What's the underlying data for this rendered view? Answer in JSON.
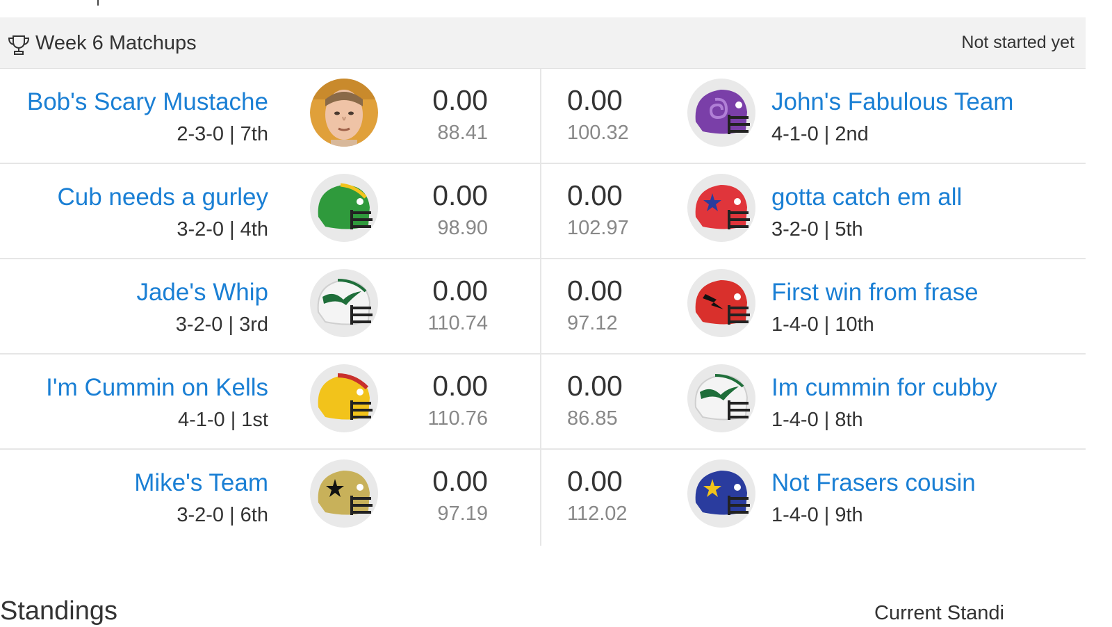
{
  "panel": {
    "title": "Week 6 Matchups",
    "status": "Not started yet",
    "icon": "trophy-icon"
  },
  "matchups": [
    {
      "home": {
        "name": "Bob's Scary Mustache",
        "record": "2-3-0 | 7th",
        "score": "0.00",
        "projected": "88.41",
        "avatar": "face-photo"
      },
      "away": {
        "name": "John's Fabulous Team",
        "record": "4-1-0 | 2nd",
        "score": "0.00",
        "projected": "100.32",
        "avatar": "helmet-purple-swirl",
        "helmet_color": "#7a3fa8"
      }
    },
    {
      "home": {
        "name": "Cub needs a gurley",
        "record": "3-2-0 | 4th",
        "score": "0.00",
        "projected": "98.90",
        "avatar": "helmet-green",
        "helmet_color": "#2f9a3c"
      },
      "away": {
        "name": "gotta catch em all",
        "record": "3-2-0 | 5th",
        "score": "0.00",
        "projected": "102.97",
        "avatar": "helmet-red-star",
        "helmet_color": "#e0353b"
      }
    },
    {
      "home": {
        "name": "Jade's Whip",
        "record": "3-2-0 | 3rd",
        "score": "0.00",
        "projected": "110.74",
        "avatar": "helmet-white-wing",
        "helmet_color": "#f2f2f2"
      },
      "away": {
        "name": "First win from frase",
        "record": "1-4-0 | 10th",
        "score": "0.00",
        "projected": "97.12",
        "avatar": "helmet-red-bolt",
        "helmet_color": "#d9302c"
      }
    },
    {
      "home": {
        "name": "I'm Cummin on Kells",
        "record": "4-1-0 | 1st",
        "score": "0.00",
        "projected": "110.76",
        "avatar": "helmet-yellow",
        "helmet_color": "#f2c31b"
      },
      "away": {
        "name": "Im cummin for cubby",
        "record": "1-4-0 | 8th",
        "score": "0.00",
        "projected": "86.85",
        "avatar": "helmet-white-wing",
        "helmet_color": "#f2f2f2"
      }
    },
    {
      "home": {
        "name": "Mike's Team",
        "record": "3-2-0 | 6th",
        "score": "0.00",
        "projected": "97.19",
        "avatar": "helmet-gold-star",
        "helmet_color": "#c8b15a"
      },
      "away": {
        "name": "Not Frasers cousin",
        "record": "1-4-0 | 9th",
        "score": "0.00",
        "projected": "112.02",
        "avatar": "helmet-blue-star",
        "helmet_color": "#2a3c9e"
      }
    }
  ],
  "standings": {
    "title": "Standings",
    "link": "Current Standi"
  },
  "colors": {
    "link": "#1a7fd4",
    "header_bg": "#f2f2f2",
    "divider": "#e6e6e6"
  }
}
